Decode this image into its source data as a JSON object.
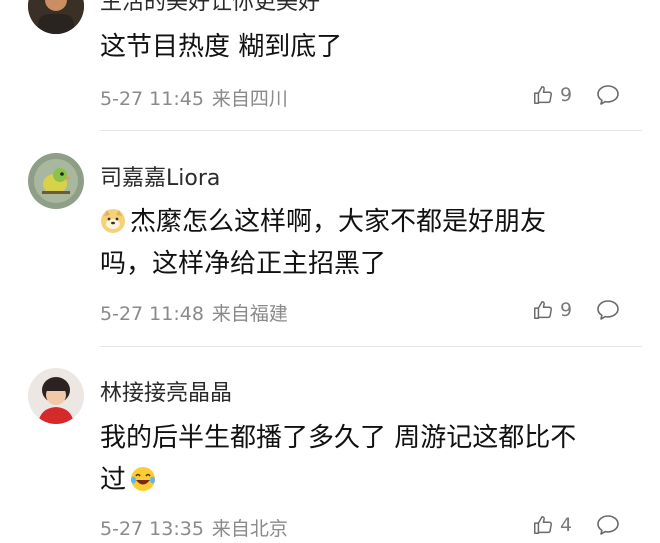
{
  "comments": [
    {
      "username": "生活的美好让你更美好",
      "text": "这节目热度 糊到底了",
      "time": "5-27 11:45",
      "location": "来自四川",
      "likes": "9"
    },
    {
      "username": "司嘉嘉Liora",
      "text_line1": "杰縻怎么这样啊，大家不都是好朋友",
      "text_line2": "吗，这样净给正主招黑了",
      "time": "5-27 11:48",
      "location": "来自福建",
      "likes": "9"
    },
    {
      "username": "林接接亮晶晶",
      "text_line1": "我的后半生都播了多久了 周游记这都比不",
      "text_line2": "过",
      "time": "5-27 13:35",
      "location": "来自北京",
      "likes": "4"
    }
  ],
  "icons": {
    "like": "thumbs-up-icon",
    "reply": "comment-bubble-icon",
    "emoji_dog": "doge-emoji-icon",
    "emoji_laugh": "laughing-tears-emoji-icon"
  }
}
